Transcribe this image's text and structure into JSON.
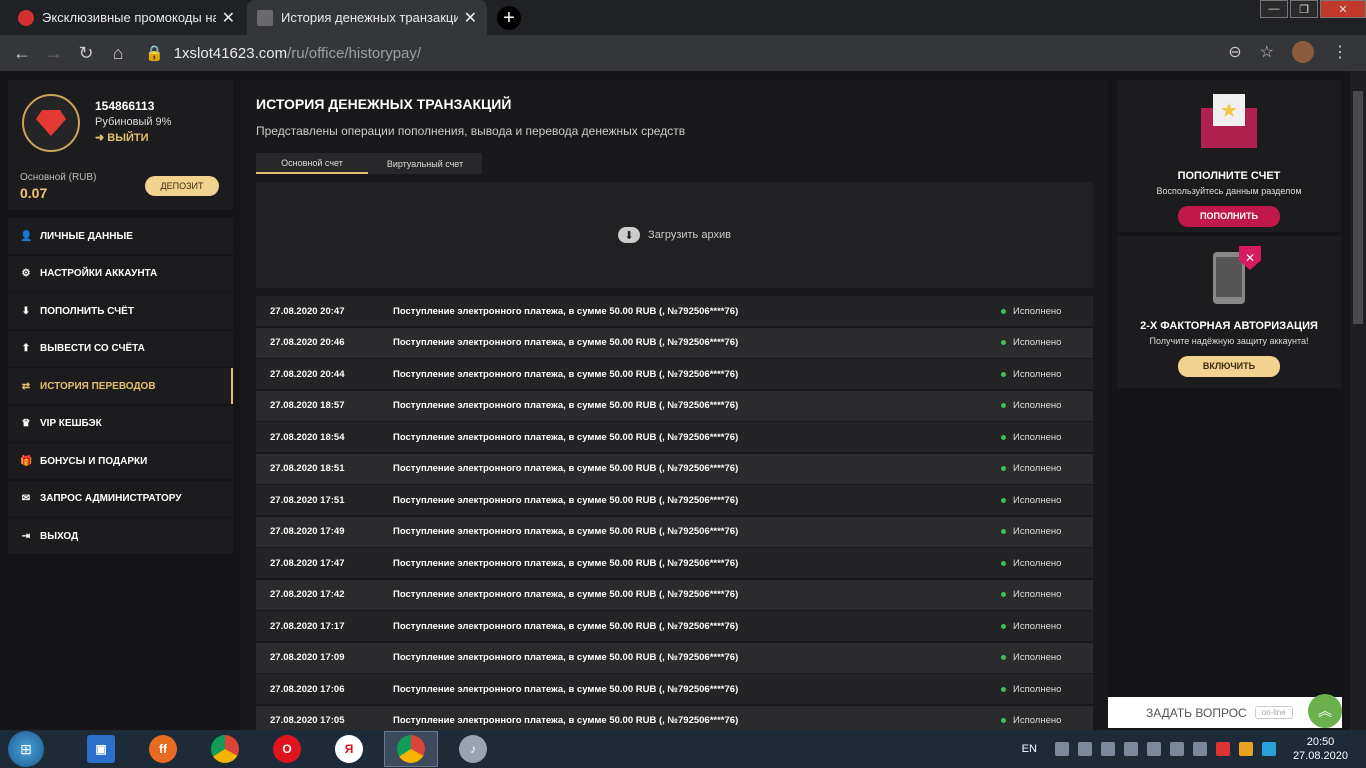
{
  "browser": {
    "tabs": [
      {
        "title": "Эксклюзивные промокоды на ф",
        "active": false
      },
      {
        "title": "История денежных транзакций",
        "active": true
      }
    ],
    "tab_close": "✕",
    "new_tab": "+",
    "url_domain": "1xslot41623.com",
    "url_path": "/ru/office/historypay/"
  },
  "profile": {
    "user_id": "154866113",
    "rank": "Рубиновый 9%",
    "logout": "ВЫЙТИ",
    "account_label": "Основной (RUB)",
    "balance": "0.07",
    "deposit": "ДЕПОЗИТ"
  },
  "menu": [
    {
      "label": "ЛИЧНЫЕ ДАННЫЕ",
      "icon": "user-icon",
      "glyph": "👤"
    },
    {
      "label": "НАСТРОЙКИ АККАУНТА",
      "icon": "gears-icon",
      "glyph": "⚙"
    },
    {
      "label": "ПОПОЛНИТЬ СЧЁТ",
      "icon": "download-icon",
      "glyph": "⬇"
    },
    {
      "label": "ВЫВЕСТИ СО СЧЁТА",
      "icon": "upload-icon",
      "glyph": "⬆"
    },
    {
      "label": "ИСТОРИЯ ПЕРЕВОДОВ",
      "icon": "transfer-icon",
      "glyph": "⇄"
    },
    {
      "label": "VIP КЕШБЭК",
      "icon": "crown-icon",
      "glyph": "♛"
    },
    {
      "label": "БОНУСЫ И ПОДАРКИ",
      "icon": "gift-icon",
      "glyph": "🎁"
    },
    {
      "label": "ЗАПРОС АДМИНИСТРАТОРУ",
      "icon": "envelope-icon",
      "glyph": "✉"
    },
    {
      "label": "ВЫХОД",
      "icon": "exit-icon",
      "glyph": "⇥"
    }
  ],
  "main": {
    "title": "ИСТОРИЯ ДЕНЕЖНЫХ ТРАНЗАКЦИЙ",
    "subtitle": "Представлены операции пополнения, вывода и перевода денежных средств",
    "tab_main": "Основной счет",
    "tab_virtual": "Виртуальный счет",
    "archive": "Загрузить архив",
    "transactions": [
      {
        "date": "27.08.2020 20:47",
        "desc": "Поступление электронного платежа, в сумме 50.00 RUB (, №792506****76)",
        "status": "Исполнено"
      },
      {
        "date": "27.08.2020 20:46",
        "desc": "Поступление электронного платежа, в сумме 50.00 RUB (, №792506****76)",
        "status": "Исполнено"
      },
      {
        "date": "27.08.2020 20:44",
        "desc": "Поступление электронного платежа, в сумме 50.00 RUB (, №792506****76)",
        "status": "Исполнено"
      },
      {
        "date": "27.08.2020 18:57",
        "desc": "Поступление электронного платежа, в сумме 50.00 RUB (, №792506****76)",
        "status": "Исполнено"
      },
      {
        "date": "27.08.2020 18:54",
        "desc": "Поступление электронного платежа, в сумме 50.00 RUB (, №792506****76)",
        "status": "Исполнено"
      },
      {
        "date": "27.08.2020 18:51",
        "desc": "Поступление электронного платежа, в сумме 50.00 RUB (, №792506****76)",
        "status": "Исполнено"
      },
      {
        "date": "27.08.2020 17:51",
        "desc": "Поступление электронного платежа, в сумме 50.00 RUB (, №792506****76)",
        "status": "Исполнено"
      },
      {
        "date": "27.08.2020 17:49",
        "desc": "Поступление электронного платежа, в сумме 50.00 RUB (, №792506****76)",
        "status": "Исполнено"
      },
      {
        "date": "27.08.2020 17:47",
        "desc": "Поступление электронного платежа, в сумме 50.00 RUB (, №792506****76)",
        "status": "Исполнено"
      },
      {
        "date": "27.08.2020 17:42",
        "desc": "Поступление электронного платежа, в сумме 50.00 RUB (, №792506****76)",
        "status": "Исполнено"
      },
      {
        "date": "27.08.2020 17:17",
        "desc": "Поступление электронного платежа, в сумме 50.00 RUB (, №792506****76)",
        "status": "Исполнено"
      },
      {
        "date": "27.08.2020 17:09",
        "desc": "Поступление электронного платежа, в сумме 50.00 RUB (, №792506****76)",
        "status": "Исполнено"
      },
      {
        "date": "27.08.2020 17:06",
        "desc": "Поступление электронного платежа, в сумме 50.00 RUB (, №792506****76)",
        "status": "Исполнено"
      },
      {
        "date": "27.08.2020 17:05",
        "desc": "Поступление электронного платежа, в сумме 50.00 RUB (, №792506****76)",
        "status": "Исполнено"
      }
    ]
  },
  "promo_deposit": {
    "title": "ПОПОЛНИТЕ СЧЕТ",
    "subtitle": "Воспользуйтесь данным разделом",
    "button": "ПОПОЛНИТЬ"
  },
  "promo_2fa": {
    "title": "2-Х ФАКТОРНАЯ АВТОРИЗАЦИЯ",
    "subtitle": "Получите надёжную защиту аккаунта!",
    "button": "ВКЛЮЧИТЬ"
  },
  "chat": {
    "label": "ЗАДАТЬ ВОПРОС",
    "status": "on-line"
  },
  "taskbar": {
    "lang": "EN",
    "time": "20:50",
    "date": "27.08.2020",
    "apps": [
      "floppy-icon",
      "firefox-icon",
      "chrome-icon",
      "opera-icon",
      "yandex-icon",
      "chrome-active-icon",
      "speaker-app-icon"
    ]
  },
  "colors": {
    "accent_gold": "#e2c06f",
    "brand_pink": "#c0184a",
    "status_green": "#3fbf5b"
  }
}
